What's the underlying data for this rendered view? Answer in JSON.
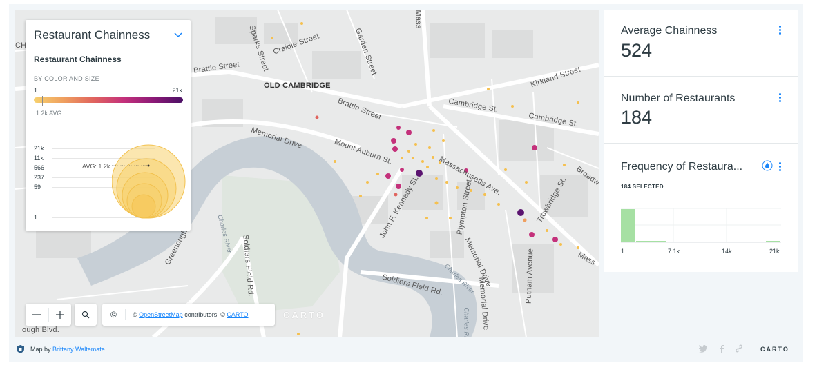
{
  "map": {
    "labels": {
      "old_cambridge": "OLD CAMBRIDGE",
      "brattle_street_1": "Brattle Street",
      "brattle_street_2": "Brattle Street",
      "craigie_street": "Craigie Street",
      "sparks_street": "Sparks Street",
      "garden_street": "Garden Street",
      "mass_ave_top": "Mass",
      "kirkland_street": "Kirkland Street",
      "cambridge_st_1": "Cambridge St.",
      "cambridge_st_2": "Cambridge St.",
      "memorial_drive_1": "Memorial Drive",
      "memorial_drive_2": "Memorial Drive",
      "memorial_drive_3": "Memorial Drive",
      "mount_auburn_st": "Mount Auburn St.",
      "massachusetts_ave": "Massachusetts Ave.",
      "john_f_kennedy_st": "John F. Kennedy St.",
      "plympton_street": "Plympton Street",
      "trowbridge_st": "Trowbridge St.",
      "putnam_avenue": "Putnam Avenue",
      "broadway": "Broadw",
      "mass_right": "Mass",
      "charles_river_1": "Charles River",
      "charles_river_2": "Charles River",
      "charles_river_3": "Charles River",
      "soldiers_field_rd_1": "Soldiers Field Rd.",
      "soldiers_field_rd_2": "Soldiers Field Rd.",
      "greenough": "Greenough",
      "ough_blvd": "ough Blvd.",
      "chv": "CHV"
    },
    "attribution_prefix": "©",
    "attribution_osm": "OpenStreetMap",
    "attribution_mid": " contributors, © ",
    "attribution_carto": "CARTO",
    "watermark": "CARTO",
    "copyright_btn": "©"
  },
  "legend": {
    "title": "Restaurant Chainness",
    "subtitle": "Restaurant Chainness",
    "by_color_and_size": "BY COLOR AND SIZE",
    "gradient_min": "1",
    "gradient_max": "21k",
    "avg_label": "1.2k AVG",
    "size_labels": [
      "21k",
      "11k",
      "566",
      "237",
      "59",
      "1"
    ],
    "size_avg": "AVG: 1.2k",
    "gradient_colors": [
      "#f7d16e",
      "#e0645e",
      "#c4317b",
      "#4b1065"
    ]
  },
  "widgets": {
    "avg_chainness": {
      "title": "Average Chainness",
      "value": "524"
    },
    "num_restaurants": {
      "title": "Number of Restaurants",
      "value": "184"
    },
    "frequency": {
      "title": "Frequency of Restaura...",
      "selected": "184 SELECTED",
      "x_labels": [
        "1",
        "7.1k",
        "14k",
        "21k"
      ]
    }
  },
  "footer": {
    "map_by": "Map by ",
    "author": "Brittany Waltemate",
    "logo": "CARTO"
  },
  "colors": {
    "accent": "#1785fb",
    "histogram_bar": "#a6e0a3",
    "point_yellow": "#f5c04f",
    "point_magenta": "#c4317b",
    "point_purple": "#5b1470"
  },
  "icons": {
    "zoom_out": "minus-icon",
    "zoom_in": "plus-icon",
    "search": "search-icon",
    "options": "more-vertical-icon",
    "color_drop": "droplet-icon",
    "collapse": "chevron-down-icon",
    "twitter": "twitter-icon",
    "facebook": "facebook-icon",
    "link": "link-icon"
  }
}
